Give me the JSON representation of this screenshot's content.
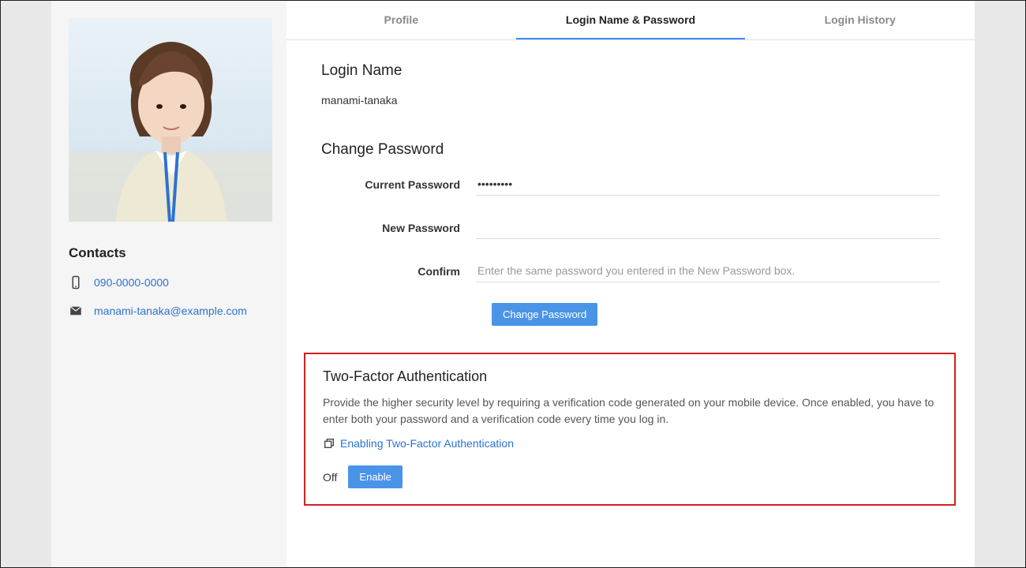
{
  "sidebar": {
    "contacts_heading": "Contacts",
    "phone": "090-0000-0000",
    "email": "manami-tanaka@example.com"
  },
  "tabs": {
    "profile": "Profile",
    "login_pw": "Login Name & Password",
    "history": "Login History"
  },
  "login_name": {
    "heading": "Login Name",
    "value": "manami-tanaka"
  },
  "change_pw": {
    "heading": "Change Password",
    "current_label": "Current Password",
    "current_value": "•••••••••",
    "new_label": "New Password",
    "confirm_label": "Confirm",
    "confirm_placeholder": "Enter the same password you entered in the New Password box.",
    "button": "Change Password"
  },
  "twofa": {
    "heading": "Two-Factor Authentication",
    "description": "Provide the higher security level by requiring a verification code generated on your mobile device. Once enabled, you have to enter both your password and a verification code every time you log in.",
    "link": "Enabling Two-Factor Authentication",
    "status": "Off",
    "enable_button": "Enable"
  }
}
